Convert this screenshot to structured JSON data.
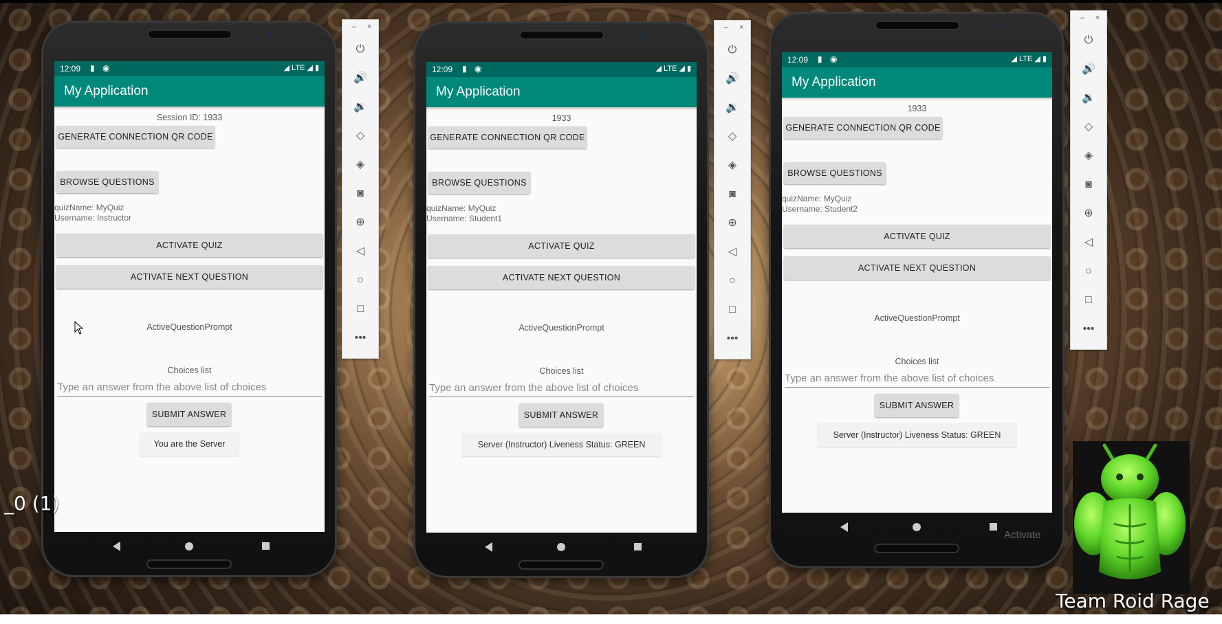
{
  "app": {
    "title": "My Application"
  },
  "status_bar": {
    "time": "12:09",
    "network": "LTE"
  },
  "phones": [
    {
      "session_text": "Session ID: 1933",
      "generate_qr_label": "GENERATE CONNECTION QR CODE",
      "browse_questions_label": "BROWSE QUESTIONS",
      "quiz_name_line": "quizName: MyQuiz",
      "username_line": "Username: Instructor",
      "activate_quiz_label": "ACTIVATE QUIZ",
      "activate_next_label": "ACTIVATE NEXT QUESTION",
      "question_prompt": "ActiveQuestionPrompt",
      "choices_list": "Choices list",
      "answer_placeholder": "Type an answer from the above list of choices",
      "submit_label": "SUBMIT ANSWER",
      "status_text": "You are the Server"
    },
    {
      "session_text": "1933",
      "generate_qr_label": "GENERATE CONNECTION QR CODE",
      "browse_questions_label": "BROWSE QUESTIONS",
      "quiz_name_line": "quizName: MyQuiz",
      "username_line": "Username: Student1",
      "activate_quiz_label": "ACTIVATE QUIZ",
      "activate_next_label": "ACTIVATE NEXT QUESTION",
      "question_prompt": "ActiveQuestionPrompt",
      "choices_list": "Choices list",
      "answer_placeholder": "Type an answer from the above list of choices",
      "submit_label": "SUBMIT ANSWER",
      "status_text": "Server (Instructor) Liveness Status: GREEN"
    },
    {
      "session_text": "1933",
      "generate_qr_label": "GENERATE CONNECTION QR CODE",
      "browse_questions_label": "BROWSE QUESTIONS",
      "quiz_name_line": "quizName: MyQuiz",
      "username_line": "Username: Student2",
      "activate_quiz_label": "ACTIVATE QUIZ",
      "activate_next_label": "ACTIVATE NEXT QUESTION",
      "question_prompt": "ActiveQuestionPrompt",
      "choices_list": "Choices list",
      "answer_placeholder": "Type an answer from the above list of choices",
      "submit_label": "SUBMIT ANSWER",
      "status_text": "Server (Instructor) Liveness Status: GREEN"
    }
  ],
  "emulator_toolbar": {
    "minimize": "–",
    "close": "×",
    "icons": [
      "power-icon",
      "volume-up-icon",
      "volume-down-icon",
      "rotate-left-icon",
      "rotate-right-icon",
      "camera-icon",
      "zoom-icon",
      "back-icon",
      "home-icon",
      "overview-icon",
      "more-icon"
    ]
  },
  "overlay": {
    "left_label": "_0 (1)",
    "activate_watermark": "Activate",
    "team_label": "Team Roid Rage"
  },
  "colors": {
    "status_bar": "#00695f",
    "app_bar": "#00897b",
    "screen_bg": "#fafafa",
    "button_bg": "#dcdcdc",
    "mascot_green": "#5fd629"
  }
}
